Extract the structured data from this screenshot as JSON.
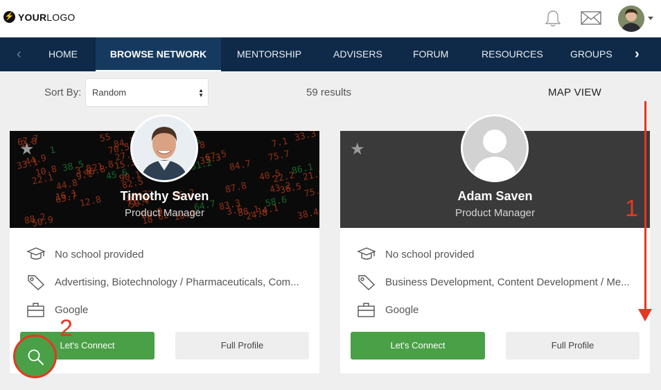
{
  "header": {
    "logo_bold": "YOUR",
    "logo_thin": "LOGO",
    "logo_mark": "⚡",
    "icons": [
      "bell-icon",
      "mail-icon",
      "avatar",
      "caret-down-icon"
    ]
  },
  "nav": {
    "prev": "‹",
    "next": "›",
    "items": [
      {
        "label": "HOME"
      },
      {
        "label": "BROWSE NETWORK",
        "active": true
      },
      {
        "label": "MENTORSHIP"
      },
      {
        "label": "ADVISERS"
      },
      {
        "label": "FORUM"
      },
      {
        "label": "RESOURCES"
      },
      {
        "label": "GROUPS"
      }
    ]
  },
  "toolbar": {
    "sort_label": "Sort By:",
    "sort_value": "Random",
    "results": "59 results",
    "map_view": "MAP VIEW"
  },
  "cards": [
    {
      "name": "Timothy Saven",
      "title": "Product Manager",
      "school": "No school provided",
      "industries": "Advertising, Biotechnology / Pharmaceuticals, Com...",
      "company": "Google",
      "connect": "Let's Connect",
      "profile": "Full Profile"
    },
    {
      "name": "Adam Saven",
      "title": "Product Manager",
      "school": "No school provided",
      "industries": "Business Development, Content Development / Me...",
      "company": "Google",
      "connect": "Let's Connect",
      "profile": "Full Profile"
    }
  ],
  "annotations": {
    "step1": "1",
    "step2": "2",
    "color": "#e53722"
  },
  "colors": {
    "nav_bg": "#0e2a48",
    "accent_green": "#4aa046"
  }
}
